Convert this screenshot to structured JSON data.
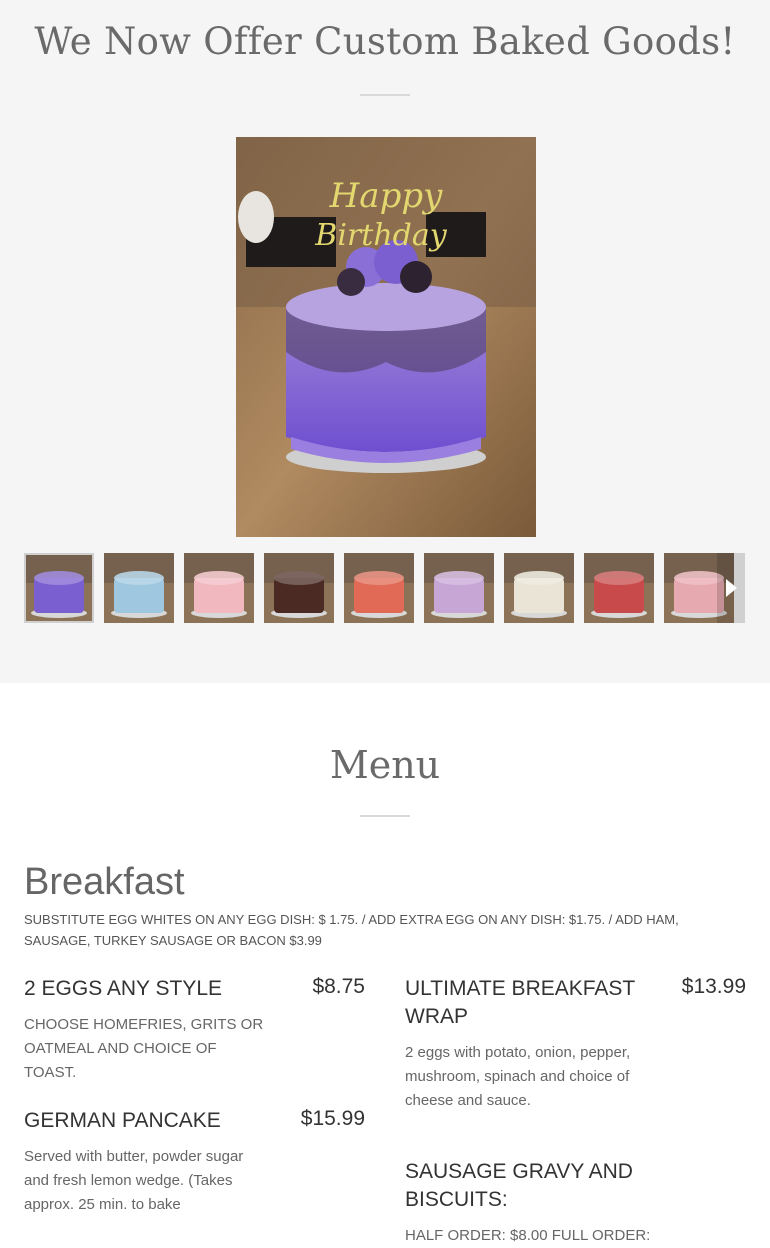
{
  "gallery": {
    "title": "We Now Offer Custom Baked Goods!",
    "main_image": {
      "icon": "birthday-cake-photo",
      "topper_text": "Happy Birthday"
    },
    "thumbnails": [
      {
        "name": "thumb-purple-birthday-cake",
        "color": "#7a5fd0"
      },
      {
        "name": "thumb-frozen-cake",
        "color": "#9fc8e0"
      },
      {
        "name": "thumb-wifey-cake",
        "color": "#f2b8c0"
      },
      {
        "name": "thumb-chocolate-cake",
        "color": "#4a2a22"
      },
      {
        "name": "thumb-money-cake",
        "color": "#e06a55"
      },
      {
        "name": "thumb-floral-cake",
        "color": "#c7a6d6"
      },
      {
        "name": "thumb-heart-cake",
        "color": "#e9e4d6"
      },
      {
        "name": "thumb-cupcakes-box",
        "color": "#c94a4a"
      },
      {
        "name": "thumb-pink-crown-cake",
        "color": "#e7a9b0"
      }
    ],
    "next_icon": "chevron-right-icon"
  },
  "menu": {
    "title": "Menu",
    "category": {
      "title": "Breakfast",
      "note": "SUBSTITUTE EGG WHITES ON ANY EGG DISH: $ 1.75. / ADD EXTRA EGG ON ANY DISH: $1.75. / ADD HAM, SAUSAGE, TURKEY SAUSAGE OR BACON $3.99"
    },
    "items": [
      {
        "name": "2 EGGS ANY STYLE",
        "price": "$8.75",
        "desc": "CHOOSE HOMEFRIES, GRITS OR OATMEAL AND CHOICE OF TOAST."
      },
      {
        "name": "ULTIMATE BREAKFAST WRAP",
        "price": "$13.99",
        "desc": "2 eggs with potato, onion, pepper, mushroom, spinach and choice of cheese and sauce."
      },
      {
        "name": "GERMAN PANCAKE",
        "price": "$15.99",
        "desc": "Served with butter, powder sugar and fresh lemon wedge. (Takes approx. 25 min. to bake"
      },
      {
        "name": "SAUSAGE GRAVY AND BISCUITS:",
        "price": "",
        "desc": "HALF ORDER: $8.00 FULL ORDER:"
      }
    ]
  }
}
